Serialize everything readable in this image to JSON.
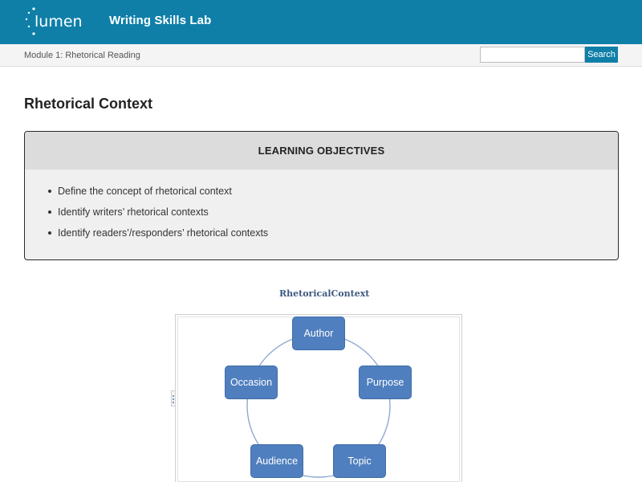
{
  "header": {
    "logo_text": "lumen",
    "site_title": "Writing Skills Lab",
    "background_color": "#0f7fa8"
  },
  "breadcrumb": {
    "label": "Module 1: Rhetorical Reading"
  },
  "search": {
    "value": "",
    "button_label": "Search"
  },
  "page": {
    "title": "Rhetorical Context"
  },
  "objectives": {
    "heading": "LEARNING OBJECTIVES",
    "items": [
      "Define the concept of rhetorical context",
      "Identify writers’ rhetorical contexts",
      "Identify readers’/responders’ rhetorical contexts"
    ]
  },
  "diagram": {
    "title": "RhetoricalContext",
    "nodes": [
      "Author",
      "Purpose",
      "Topic",
      "Audience",
      "Occasion"
    ],
    "node_color": "#4f7fbf",
    "cycle_color": "#8ea9cf"
  }
}
